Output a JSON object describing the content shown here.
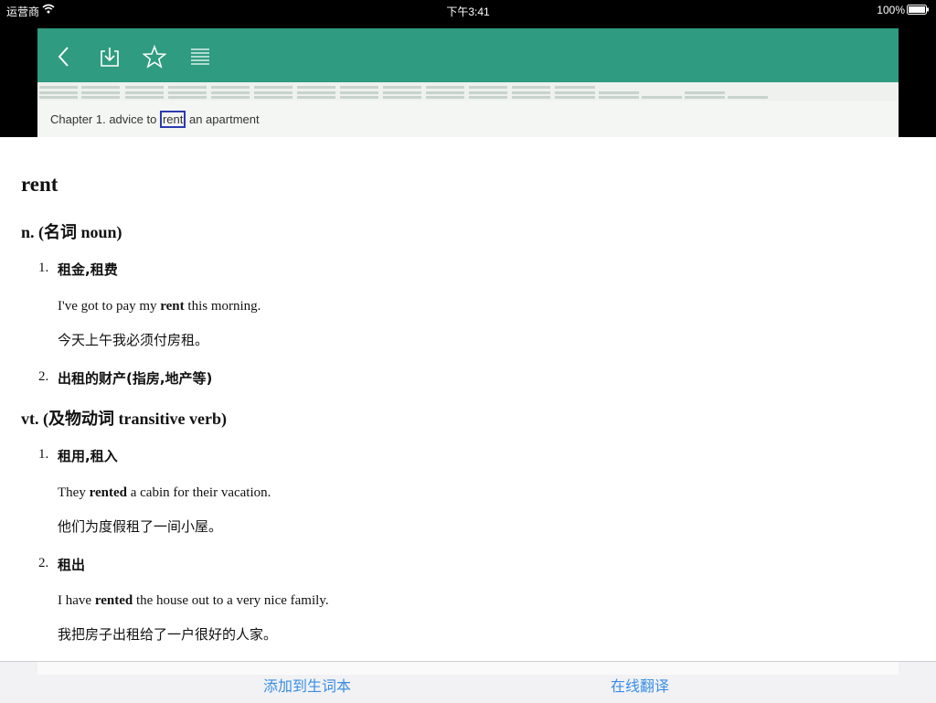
{
  "status": {
    "carrier": "运营商",
    "time": "下午3:41",
    "battery": "100%"
  },
  "toolbar": {
    "icons": [
      "back-icon",
      "download-icon",
      "star-icon",
      "list-icon"
    ]
  },
  "reader": {
    "chapter_before": "Chapter 1. advice to ",
    "chapter_word": "rent",
    "chapter_after": " an apartment"
  },
  "entry": {
    "headword": "rent",
    "pos1": "n. (名词 noun)",
    "pos1_senses": [
      {
        "num": "1.",
        "text": "租金,租费",
        "ex_before": "I've got to pay my ",
        "ex_bold": "rent",
        "ex_after": " this morning.",
        "zh": "今天上午我必须付房租。"
      },
      {
        "num": "2.",
        "text": "出租的财产(指房,地产等)"
      }
    ],
    "pos2": "vt. (及物动词 transitive verb)",
    "pos2_senses": [
      {
        "num": "1.",
        "text": "租用,租入",
        "ex_before": "They ",
        "ex_bold": "rented",
        "ex_after": " a cabin for their vacation.",
        "zh": "他们为度假租了一间小屋。"
      },
      {
        "num": "2.",
        "text": "租出",
        "ex_before": "I have ",
        "ex_bold": "rented",
        "ex_after": " the house out to a very nice family.",
        "zh": "我把房子出租给了一户很好的人家。"
      }
    ]
  },
  "bottom": {
    "add_label": "添加到生词本",
    "translate_label": "在线翻译"
  },
  "colors": {
    "toolbar": "#2f9b80",
    "link": "#3a8ee6",
    "highlight_border": "#2a3bb0"
  }
}
